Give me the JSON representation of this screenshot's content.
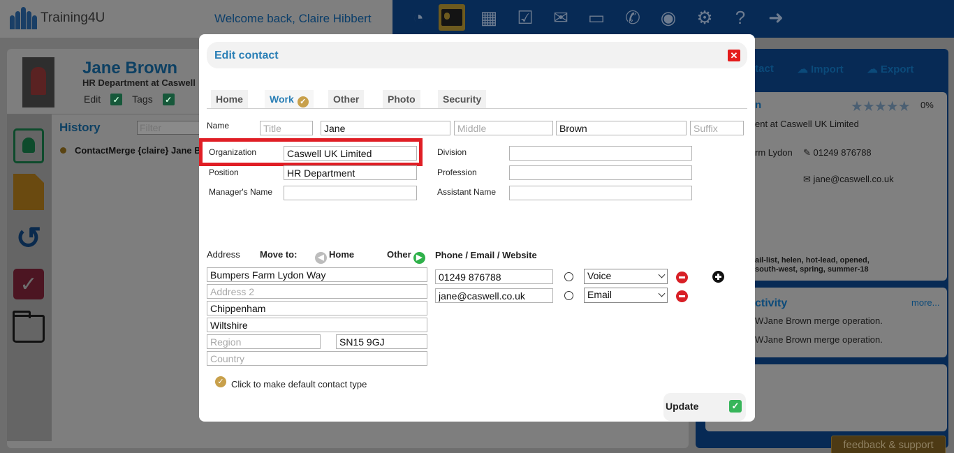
{
  "app": {
    "name": "Training4U",
    "welcome": "Welcome back, Claire Hibbert"
  },
  "nav": {
    "icons": [
      "dashboard-icon",
      "contacts-card-icon",
      "calendar-icon",
      "tasks-check-icon",
      "mail-icon",
      "folder-icon",
      "phone-icon",
      "user-icon",
      "settings-gear-icon",
      "help-icon",
      "logout-arrow-icon"
    ]
  },
  "contact": {
    "name": "Jane Brown",
    "role": "HR Department at Caswell",
    "actions": {
      "edit": "Edit",
      "tags": "Tags"
    }
  },
  "history": {
    "title": "History",
    "filter_placeholder": "Filter",
    "entry": "ContactMerge {claire} Jane B"
  },
  "right_panel": {
    "toolbar": {
      "contact": "ntact",
      "import": "Import",
      "export": "Export"
    },
    "name_fragment": "n",
    "rating_percent": "0%",
    "company_line": "ent at Caswell Lim",
    "company_line_full": "ent at Caswell UK Limited",
    "address_fragment": "rm Lydon",
    "phone": "01249 876788",
    "email": "jane@caswell.co.uk",
    "tags": "ail-list,   helen,   hot-lead,   opened,",
    "tags2": "south-west,   spring,   summer-18",
    "activity_title": "ctivity",
    "activity_more": "more...",
    "activity_1": "WJane Brown merge operation.",
    "activity_2": "WJane Brown merge operation.",
    "feedback": "feedback & support"
  },
  "modal": {
    "title": "Edit contact",
    "close_icon": "close-icon",
    "tabs": [
      {
        "label": "Home"
      },
      {
        "label": "Work"
      },
      {
        "label": "Other"
      },
      {
        "label": "Photo"
      },
      {
        "label": "Security"
      }
    ],
    "active_tab": "Work",
    "name": {
      "label": "Name",
      "title_placeholder": "Title",
      "first": "Jane",
      "middle_placeholder": "Middle",
      "last": "Brown",
      "suffix_placeholder": "Suffix"
    },
    "work": {
      "organization_label": "Organization",
      "organization": "Caswell UK Limited",
      "position_label": "Position",
      "position": "HR Department",
      "manager_label": "Manager's Name",
      "manager": "",
      "division_label": "Division",
      "division": "",
      "profession_label": "Profession",
      "profession": "",
      "assistant_label": "Assistant Name",
      "assistant": ""
    },
    "address": {
      "label": "Address",
      "move_to": "Move to:",
      "home": "Home",
      "other": "Other",
      "line1": "Bumpers Farm Lydon Way",
      "line2_placeholder": "Address 2",
      "city": "Chippenham",
      "county": "Wiltshire",
      "region_placeholder": "Region",
      "postcode": "SN15 9GJ",
      "country_placeholder": "Country"
    },
    "phone_section": {
      "title": "Phone / Email / Website",
      "rows": [
        {
          "value": "01249 876788",
          "type": "Voice"
        },
        {
          "value": "jane@caswell.co.uk",
          "type": "Email"
        }
      ]
    },
    "default_text": "Click to make default contact type",
    "update_label": "Update"
  },
  "colors": {
    "accent_blue": "#2a7fb6",
    "highlight_red": "#e01e25",
    "navy": "#072a55",
    "update_green": "#37b55a"
  }
}
